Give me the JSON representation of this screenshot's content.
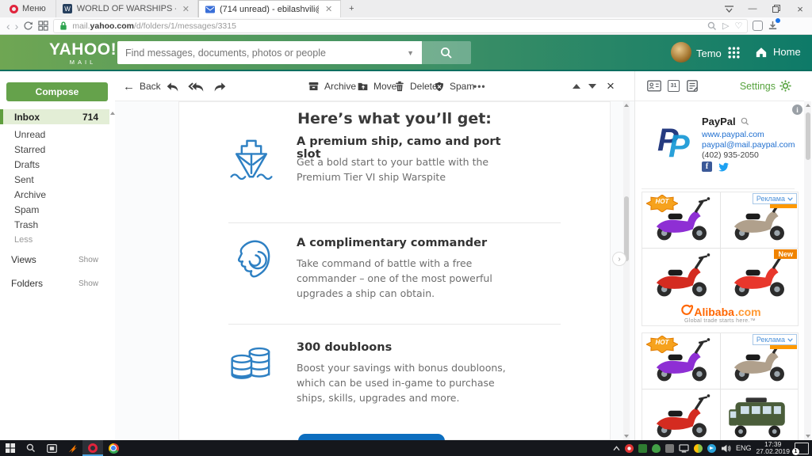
{
  "browser": {
    "menu_label": "Меню",
    "tabs": [
      {
        "title": "WORLD OF WARSHIPS ->"
      },
      {
        "title": "(714 unread) - ebilashvili@"
      }
    ],
    "new_tab": "+",
    "url_prefix": "mail.",
    "url_domain": "yahoo.com",
    "url_path": "/d/folders/1/messages/3315"
  },
  "header": {
    "logo": "YAHOO!",
    "logo_sub": "MAIL",
    "search_placeholder": "Find messages, documents, photos or people",
    "user": "Temo",
    "home": "Home"
  },
  "sidebar": {
    "compose": "Compose",
    "folders": [
      {
        "label": "Inbox",
        "count": "714"
      },
      {
        "label": "Unread"
      },
      {
        "label": "Starred"
      },
      {
        "label": "Drafts"
      },
      {
        "label": "Sent"
      },
      {
        "label": "Archive"
      },
      {
        "label": "Spam"
      },
      {
        "label": "Trash"
      },
      {
        "label": "Less"
      }
    ],
    "views_label": "Views",
    "views_action": "Show",
    "folders_label": "Folders",
    "folders_action": "Show"
  },
  "toolbar": {
    "back": "Back",
    "archive": "Archive",
    "move": "Move",
    "delete": "Delete",
    "spam": "Spam",
    "more": "•••"
  },
  "email": {
    "heading": "Here’s what you’ll get:",
    "features": [
      {
        "icon": "ship-icon",
        "title": "A premium ship, camo and port slot",
        "description": "Get a bold start to your battle with the Premium Tier VI ship Warspite"
      },
      {
        "icon": "commander-icon",
        "title": "A complimentary commander",
        "description": "Take command of battle with a free commander – one of the most powerful upgrades a ship can obtain."
      },
      {
        "icon": "doubloons-icon",
        "title": "300 doubloons",
        "description": "Boost your savings with bonus doubloons, which can be used in-game to purchase ships, skills, upgrades and more."
      }
    ]
  },
  "right_panel": {
    "settings": "Settings",
    "calendar_icon_text": "31",
    "info_icon_text": "i",
    "contact": {
      "name": "PayPal",
      "website": "www.paypal.com",
      "email": "paypal@mail.paypal.com",
      "phone": "(402) 935-2050",
      "facebook_icon_text": "f"
    },
    "ads": {
      "label": "Реклама",
      "hot": "HOT",
      "new": "New",
      "alibaba": "Alibaba",
      "alibaba_tld": ".com",
      "tagline": "Global trade starts here.™"
    }
  },
  "taskbar": {
    "lang": "ENG",
    "time": "17:39",
    "date": "27.02.2019",
    "badge": "1"
  },
  "colors": {
    "header_green_left": "#6fa653",
    "header_green_right": "#0e7a68",
    "accent_green": "#61a146",
    "icon_blue": "#2e80c3",
    "paypal_dark_blue": "#253b80",
    "paypal_light_blue": "#1799d6",
    "alibaba_orange": "#ff6600",
    "badge_orange": "#f59a1c",
    "cta_blue": "#0d6ebf"
  }
}
